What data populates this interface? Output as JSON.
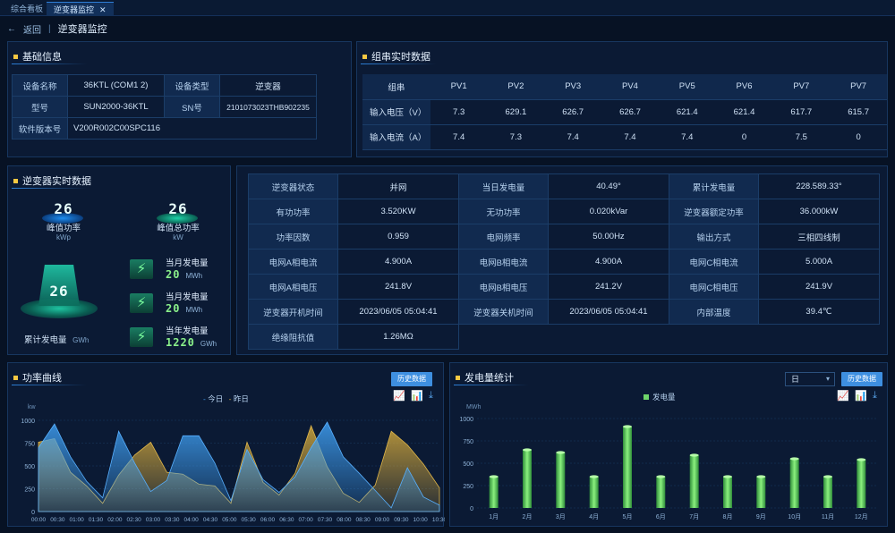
{
  "tabs": [
    {
      "label": "综合看板"
    },
    {
      "label": "逆变器监控"
    }
  ],
  "crumb": {
    "back": "返回",
    "title": "逆变器监控"
  },
  "basic": {
    "title": "基础信息",
    "rows": [
      {
        "k1": "设备名称",
        "v1": "36KTL (COM1 2)",
        "k2": "设备类型",
        "v2": "逆变器"
      },
      {
        "k1": "型号",
        "v1": "SUN2000-36KTL",
        "k2": "SN号",
        "v2": "2101073023THB902235"
      },
      {
        "k1": "软件版本号",
        "v1": "V200R002C00SPC116",
        "k2": "",
        "v2": ""
      }
    ]
  },
  "pv": {
    "title": "组串实时数据",
    "headers": [
      "组串",
      "PV1",
      "PV2",
      "PV3",
      "PV4",
      "PV5",
      "PV6",
      "PV7",
      "PV7"
    ],
    "rows": [
      {
        "label": "输入电压（V）",
        "values": [
          "7.3",
          "629.1",
          "626.7",
          "626.7",
          "621.4",
          "621.4",
          "617.7",
          "615.7"
        ]
      },
      {
        "label": "输入电流（A）",
        "values": [
          "7.4",
          "7.3",
          "7.4",
          "7.4",
          "7.4",
          "0",
          "7.5",
          "0"
        ]
      }
    ]
  },
  "inv": {
    "title": "逆变器实时数据",
    "peak_power": {
      "num": "26",
      "label": "峰值功率",
      "unit": "kWp"
    },
    "peak_total": {
      "num": "26",
      "label": "峰值总功率",
      "unit": "kW"
    },
    "cumulative": {
      "num": "26",
      "label": "累计发电量",
      "unit": "GWh"
    },
    "stats": [
      {
        "label": "当月发电量",
        "value": "20",
        "unit": "MWh"
      },
      {
        "label": "当月发电量",
        "value": "20",
        "unit": "MWh"
      },
      {
        "label": "当年发电量",
        "value": "1220",
        "unit": "GWh"
      }
    ]
  },
  "rt": {
    "rows": [
      [
        "逆变器状态",
        "并网",
        "当日发电量",
        "40.49°",
        "累计发电量",
        "228.589.33°"
      ],
      [
        "有功功率",
        "3.520KW",
        "无功功率",
        "0.020kVar",
        "逆变器额定功率",
        "36.000kW"
      ],
      [
        "功率因数",
        "0.959",
        "电网频率",
        "50.00Hz",
        "输出方式",
        "三相四线制"
      ],
      [
        "电网A相电流",
        "4.900A",
        "电网B相电流",
        "4.900A",
        "电网C相电流",
        "5.000A"
      ],
      [
        "电网A相电压",
        "241.8V",
        "电网B相电压",
        "241.2V",
        "电网C相电压",
        "241.9V"
      ],
      [
        "逆变器开机时间",
        "2023/06/05  05:04:41",
        "逆变器关机时间",
        "2023/06/05  05:04:41",
        "内部温度",
        "39.4℃"
      ],
      [
        "绝缘阻抗值",
        "1.26MΩ",
        "",
        "",
        "",
        ""
      ]
    ]
  },
  "power": {
    "title": "功率曲线",
    "button": "历史数据",
    "legend_today": "今日",
    "legend_yesterday": "昨日",
    "unit": "kw",
    "colors": {
      "today": "#3f9ff2",
      "yesterday": "#d2a83c"
    }
  },
  "gen": {
    "title": "发电量统计",
    "button": "历史数据",
    "select": "日",
    "legend": "发电量",
    "unit": "MWh"
  },
  "chart_data": [
    {
      "type": "area",
      "title": "功率曲线",
      "ylabel": "kw",
      "ylim": [
        0,
        1000
      ],
      "yticks": [
        0,
        250,
        500,
        750,
        1000
      ],
      "x": [
        "00:00",
        "00:30",
        "01:00",
        "01:30",
        "02:00",
        "02:30",
        "03:00",
        "03:30",
        "04:00",
        "04:30",
        "05:00",
        "05:30",
        "06:00",
        "06:30",
        "07:00",
        "07:30",
        "08:00",
        "08:30",
        "09:00",
        "09:30",
        "10:00",
        "10:30"
      ],
      "series": [
        {
          "name": "今日",
          "values": [
            700,
            960,
            600,
            330,
            150,
            880,
            530,
            220,
            340,
            830,
            830,
            530,
            120,
            680,
            350,
            210,
            380,
            700,
            980,
            600,
            420,
            230,
            40,
            480,
            160,
            70
          ]
        },
        {
          "name": "昨日",
          "values": [
            760,
            800,
            430,
            280,
            90,
            400,
            620,
            760,
            430,
            410,
            300,
            280,
            90,
            760,
            320,
            180,
            420,
            940,
            490,
            200,
            100,
            290,
            880,
            730,
            520,
            260
          ]
        }
      ]
    },
    {
      "type": "bar",
      "title": "发电量统计",
      "ylabel": "MWh",
      "ylim": [
        0,
        1000
      ],
      "yticks": [
        0,
        250,
        500,
        750,
        1000
      ],
      "categories": [
        "1月",
        "2月",
        "3月",
        "4月",
        "5月",
        "6月",
        "7月",
        "8月",
        "9月",
        "10月",
        "11月",
        "12月"
      ],
      "series": [
        {
          "name": "发电量",
          "values": [
            350,
            650,
            620,
            350,
            910,
            350,
            590,
            350,
            350,
            550,
            350,
            540
          ]
        }
      ]
    }
  ]
}
